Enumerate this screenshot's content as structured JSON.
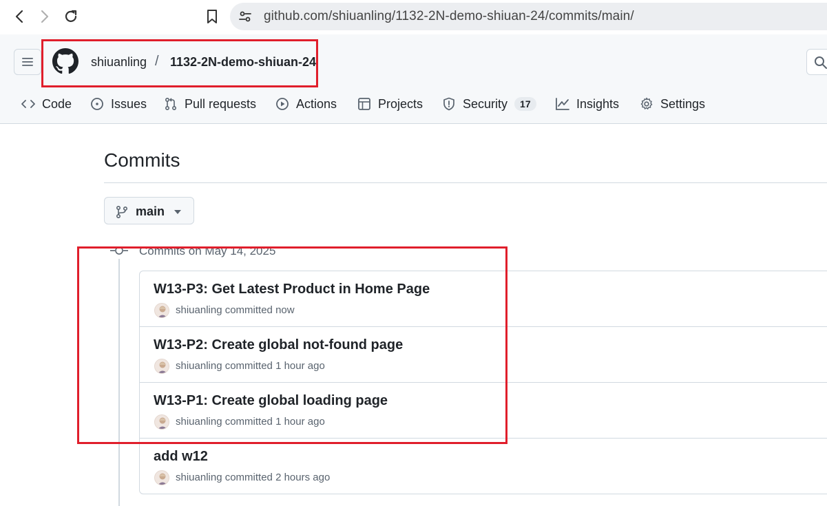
{
  "browser": {
    "url": "github.com/shiuanling/1132-2N-demo-shiuan-24/commits/main/"
  },
  "header": {
    "owner": "shiuanling",
    "separator": "/",
    "repo": "1132-2N-demo-shiuan-24"
  },
  "tabs": [
    {
      "label": "Code",
      "icon": "code-icon"
    },
    {
      "label": "Issues",
      "icon": "issue-icon"
    },
    {
      "label": "Pull requests",
      "icon": "pull-request-icon"
    },
    {
      "label": "Actions",
      "icon": "play-icon"
    },
    {
      "label": "Projects",
      "icon": "table-icon"
    },
    {
      "label": "Security",
      "icon": "shield-icon",
      "counter": "17"
    },
    {
      "label": "Insights",
      "icon": "graph-icon"
    },
    {
      "label": "Settings",
      "icon": "gear-icon"
    }
  ],
  "main": {
    "title": "Commits",
    "branch": "main",
    "group_heading": "Commits on May 14, 2025",
    "commits": [
      {
        "message": "W13-P3: Get Latest Product in Home Page",
        "meta": "shiuanling committed now"
      },
      {
        "message": "W13-P2: Create global not-found page",
        "meta": "shiuanling committed 1 hour ago"
      },
      {
        "message": "W13-P1: Create global loading page",
        "meta": "shiuanling committed 1 hour ago"
      },
      {
        "message": "add w12",
        "meta": "shiuanling committed 2 hours ago"
      }
    ]
  },
  "colors": {
    "highlight": "#e01e2b",
    "border": "#d1d9e0",
    "text": "#1f2328",
    "muted": "#59636e"
  }
}
